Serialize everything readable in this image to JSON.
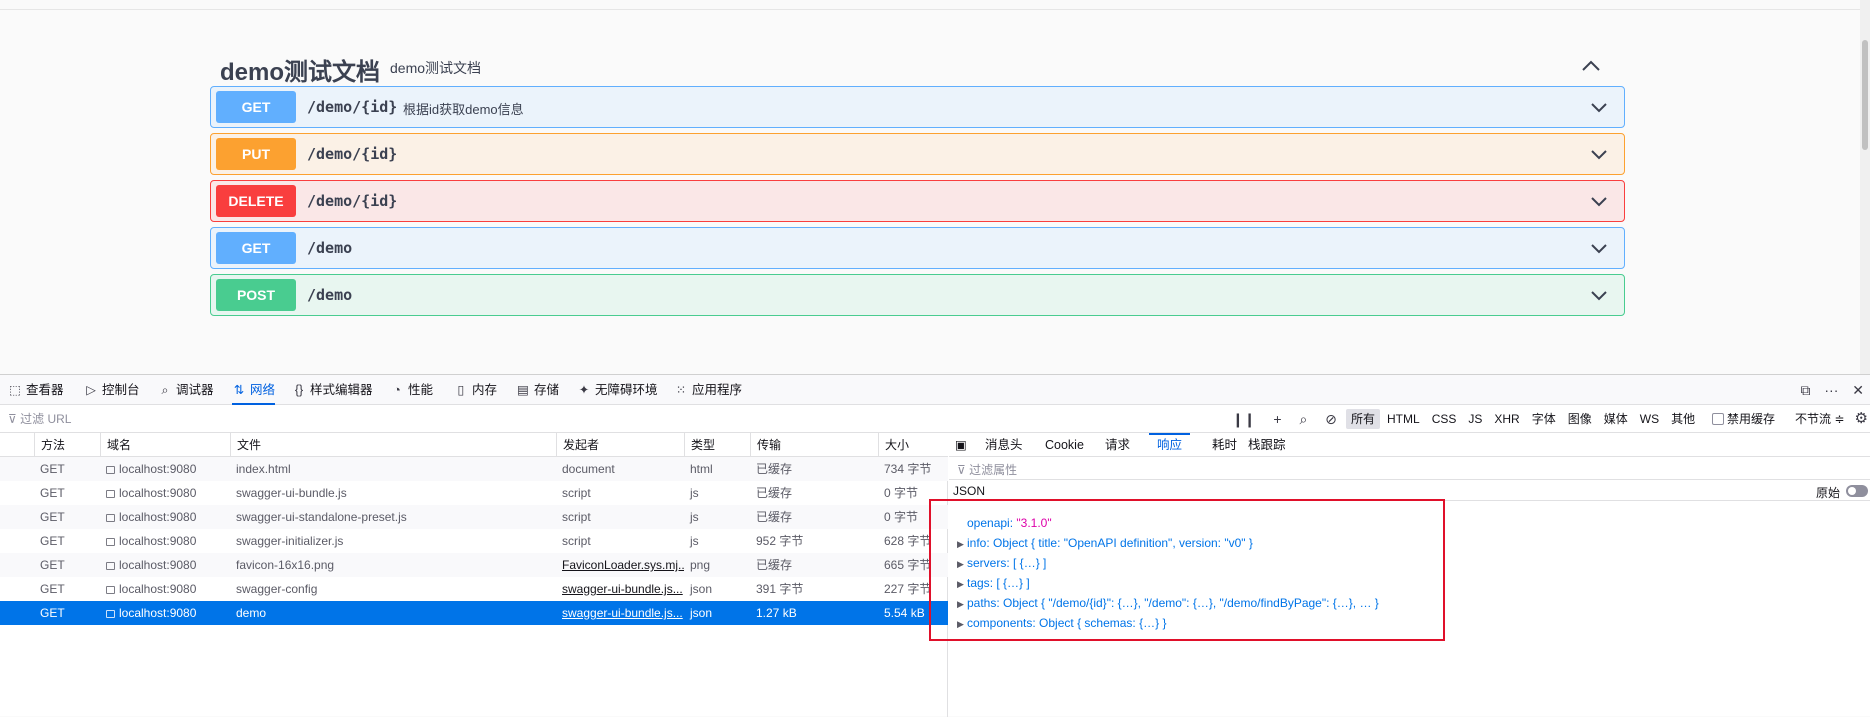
{
  "swagger": {
    "title": "demo测试文档",
    "description": "demo测试文档",
    "operations": [
      {
        "method": "GET",
        "path": "/demo/{id}",
        "summary": "根据id获取demo信息",
        "kind": "get"
      },
      {
        "method": "PUT",
        "path": "/demo/{id}",
        "summary": "",
        "kind": "put"
      },
      {
        "method": "DELETE",
        "path": "/demo/{id}",
        "summary": "",
        "kind": "delete"
      },
      {
        "method": "GET",
        "path": "/demo",
        "summary": "",
        "kind": "get"
      },
      {
        "method": "POST",
        "path": "/demo",
        "summary": "",
        "kind": "post"
      }
    ]
  },
  "devtools": {
    "tabs": [
      {
        "label": "查看器",
        "icon": "inspector-icon"
      },
      {
        "label": "控制台",
        "icon": "console-icon"
      },
      {
        "label": "调试器",
        "icon": "debugger-icon"
      },
      {
        "label": "网络",
        "icon": "network-icon"
      },
      {
        "label": "样式编辑器",
        "icon": "style-editor-icon"
      },
      {
        "label": "性能",
        "icon": "performance-icon"
      },
      {
        "label": "内存",
        "icon": "memory-icon"
      },
      {
        "label": "存储",
        "icon": "storage-icon"
      },
      {
        "label": "无障碍环境",
        "icon": "accessibility-icon"
      },
      {
        "label": "应用程序",
        "icon": "application-icon"
      }
    ],
    "active_tab": "网络",
    "filter_placeholder": "过滤 URL",
    "type_filters": [
      "所有",
      "HTML",
      "CSS",
      "JS",
      "XHR",
      "字体",
      "图像",
      "媒体",
      "WS",
      "其他"
    ],
    "active_type_filter": "所有",
    "disable_cache_label": "禁用缓存",
    "throttle_label": "不节流 ≑",
    "columns": [
      "方法",
      "域名",
      "文件",
      "发起者",
      "类型",
      "传输",
      "大小"
    ],
    "requests": [
      {
        "method": "GET",
        "domain": "localhost:9080",
        "file": "index.html",
        "initiator": "document",
        "initiator_link": false,
        "type": "html",
        "transfer": "已缓存",
        "size": "734 字节"
      },
      {
        "method": "GET",
        "domain": "localhost:9080",
        "file": "swagger-ui-bundle.js",
        "initiator": "script",
        "initiator_link": false,
        "type": "js",
        "transfer": "已缓存",
        "size": "0 字节"
      },
      {
        "method": "GET",
        "domain": "localhost:9080",
        "file": "swagger-ui-standalone-preset.js",
        "initiator": "script",
        "initiator_link": false,
        "type": "js",
        "transfer": "已缓存",
        "size": "0 字节"
      },
      {
        "method": "GET",
        "domain": "localhost:9080",
        "file": "swagger-initializer.js",
        "initiator": "script",
        "initiator_link": false,
        "type": "js",
        "transfer": "952 字节",
        "size": "628 字节"
      },
      {
        "method": "GET",
        "domain": "localhost:9080",
        "file": "favicon-16x16.png",
        "initiator": "FaviconLoader.sys.mj...",
        "initiator_link": true,
        "type": "png",
        "transfer": "已缓存",
        "size": "665 字节"
      },
      {
        "method": "GET",
        "domain": "localhost:9080",
        "file": "swagger-config",
        "initiator": "swagger-ui-bundle.js...",
        "initiator_link": true,
        "type": "json",
        "transfer": "391 字节",
        "size": "227 字节"
      },
      {
        "method": "GET",
        "domain": "localhost:9080",
        "file": "demo",
        "initiator": "swagger-ui-bundle.js...",
        "initiator_link": true,
        "type": "json",
        "transfer": "1.27 kB",
        "size": "5.54 kB",
        "selected": true
      }
    ],
    "response_tabs": [
      "消息头",
      "Cookie",
      "请求",
      "响应",
      "耗时",
      "栈跟踪"
    ],
    "active_response_tab": "响应",
    "filter_props_placeholder": "过滤属性",
    "json_label": "JSON",
    "raw_label": "原始",
    "json_tree": [
      {
        "key": "openapi",
        "value": "\"3.1.0\"",
        "value_type": "string",
        "expandable": false
      },
      {
        "key": "info",
        "value": "Object { title: \"OpenAPI definition\", version: \"v0\" }",
        "value_type": "object",
        "expandable": true
      },
      {
        "key": "servers",
        "value": "[ {…} ]",
        "value_type": "object",
        "expandable": true
      },
      {
        "key": "tags",
        "value": "[ {…} ]",
        "value_type": "object",
        "expandable": true
      },
      {
        "key": "paths",
        "value": "Object { \"/demo/{id}\": {…}, \"/demo\": {…}, \"/demo/findByPage\": {…}, … }",
        "value_type": "object",
        "expandable": true
      },
      {
        "key": "components",
        "value": "Object { schemas: {…} }",
        "value_type": "object",
        "expandable": true
      }
    ]
  }
}
